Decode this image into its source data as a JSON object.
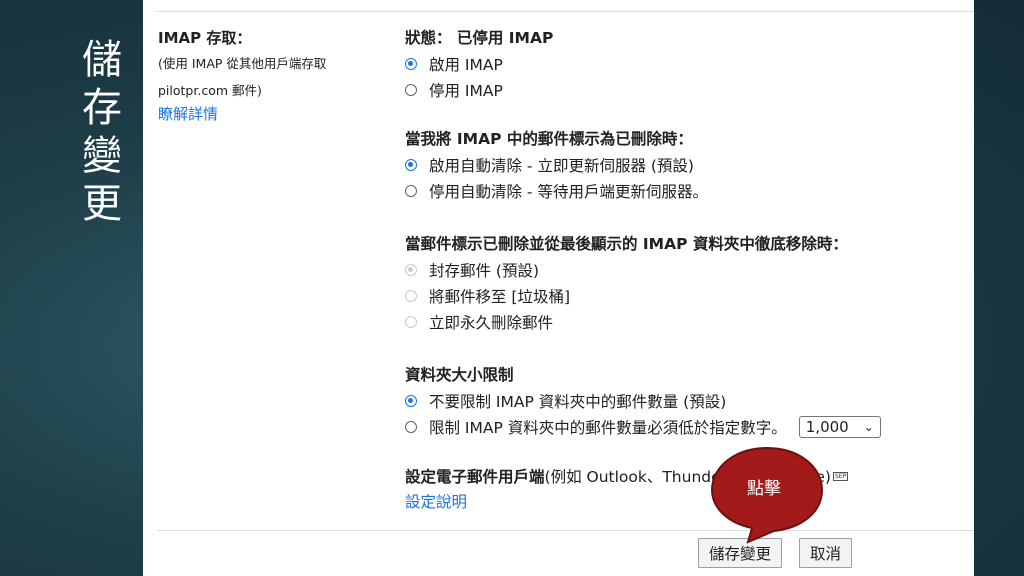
{
  "slide": {
    "title_chars": [
      "儲",
      "存",
      "變",
      "更"
    ]
  },
  "imap": {
    "label": "IMAP 存取：",
    "description_line1": "(使用 IMAP 從其他用戶端存取",
    "description_line2": "pilotpr.com 郵件)",
    "learn_more": "瞭解詳情",
    "status": "狀態： 已停用 IMAP",
    "enable_option": "啟用 IMAP",
    "disable_option": "停用 IMAP",
    "selected": "enable"
  },
  "expunge": {
    "title": "當我將 IMAP 中的郵件標示為已刪除時：",
    "options": [
      {
        "label": "啟用自動清除 - 立即更新伺服器 (預設)",
        "checked": true
      },
      {
        "label": "停用自動清除 - 等待用戶端更新伺服器。",
        "checked": false
      }
    ]
  },
  "deletion": {
    "title": "當郵件標示已刪除並從最後顯示的 IMAP 資料夾中徹底移除時：",
    "options": [
      {
        "label": "封存郵件 (預設)",
        "checked": true
      },
      {
        "label": "將郵件移至 [垃圾桶]",
        "checked": false
      },
      {
        "label": "立即永久刪除郵件",
        "checked": false
      }
    ]
  },
  "folder_limit": {
    "title": "資料夾大小限制",
    "options": [
      {
        "label": "不要限制 IMAP 資料夾中的郵件數量 (預設)",
        "checked": true
      },
      {
        "label": "限制 IMAP 資料夾中的郵件數量必須低於指定數字。",
        "checked": false
      }
    ],
    "select_value": "1,000"
  },
  "client": {
    "title_bold": "設定電子郵件用戶端",
    "title_rest": " (例如 Outlook、Thunderbird、iPhone)",
    "sep_glyph": "SEP",
    "instructions_link": "設定說明"
  },
  "buttons": {
    "save": "儲存變更",
    "cancel": "取消"
  },
  "callout": {
    "text": "點擊",
    "color": "#a31a1a"
  }
}
